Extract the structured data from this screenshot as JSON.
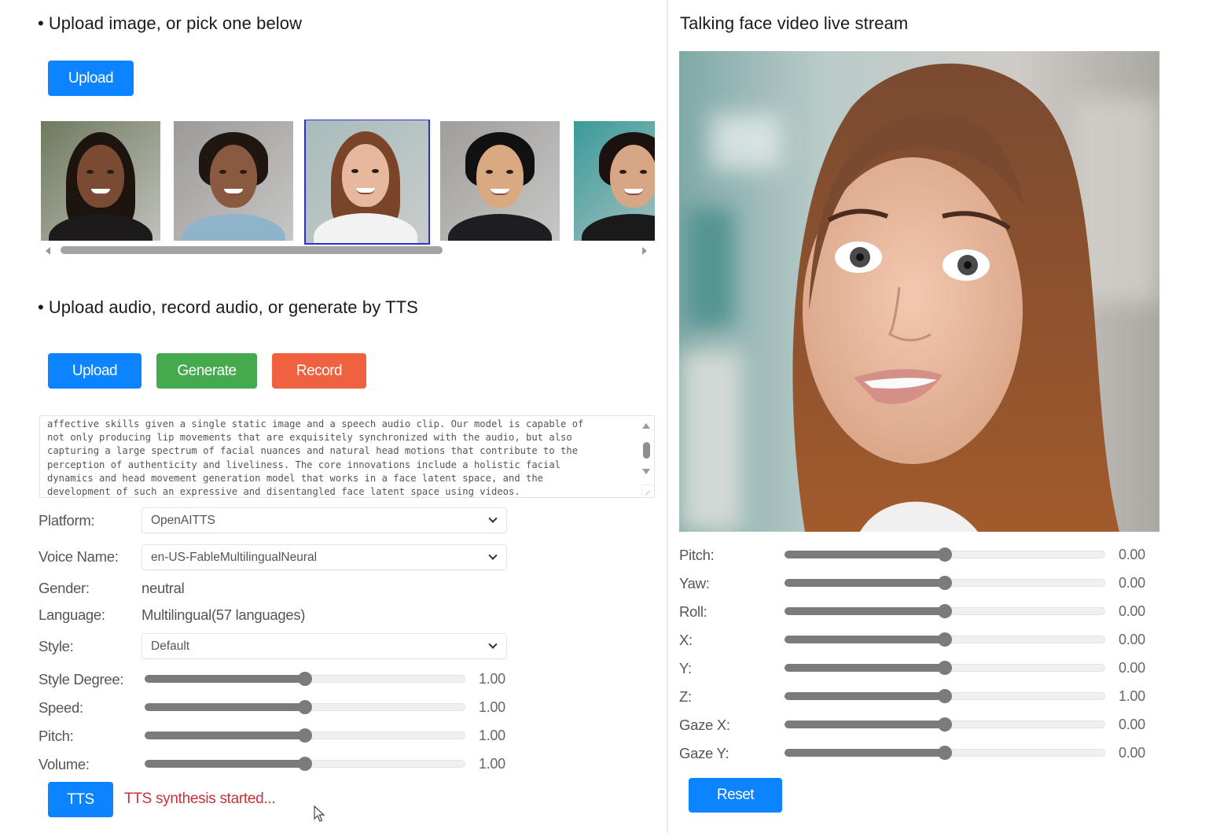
{
  "image_section": {
    "title": "Upload image, or pick one below",
    "upload_label": "Upload",
    "thumbnails": [
      {
        "name": "woman-curly-hair",
        "selected": false,
        "colors": {
          "bg": "#6f7a5d",
          "skin": "#7a4a32",
          "hair": "#1e140f",
          "clothes": "#1c1a1a"
        }
      },
      {
        "name": "man-short-hair",
        "selected": false,
        "colors": {
          "bg": "#9c9a98",
          "skin": "#8a5a40",
          "hair": "#1f1612",
          "clothes": "#8fb3c9"
        }
      },
      {
        "name": "woman-long-brown-hair",
        "selected": true,
        "colors": {
          "bg": "#a7bcbb",
          "skin": "#e8b89e",
          "hair": "#7a4428",
          "clothes": "#f2f2f2"
        }
      },
      {
        "name": "man-suit",
        "selected": false,
        "colors": {
          "bg": "#a09e9c",
          "skin": "#d9a982",
          "hair": "#111111",
          "clothes": "#1e1e22"
        }
      },
      {
        "name": "woman-short-dark-hair",
        "selected": false,
        "colors": {
          "bg": "#3a9a9a",
          "skin": "#d7a684",
          "hair": "#1b1210",
          "clothes": "#1a1a1a"
        }
      }
    ]
  },
  "audio_section": {
    "title": "Upload audio, record audio, or generate by TTS",
    "upload_label": "Upload",
    "generate_label": "Generate",
    "record_label": "Record",
    "tts_text": "affective skills given a single static image and a speech audio clip. Our model is capable of\nnot only producing lip movements that are exquisitely synchronized with the audio, but also\ncapturing a large spectrum of facial nuances and natural head motions that contribute to the\nperception of authenticity and liveliness. The core innovations include a holistic facial\ndynamics and head movement generation model that works in a face latent space, and the\ndevelopment of such an expressive and disentangled face latent space using videos.",
    "platform_label": "Platform:",
    "platform_value": "OpenAITTS",
    "voice_label": "Voice Name:",
    "voice_value": "en-US-FableMultilingualNeural",
    "gender_label": "Gender:",
    "gender_value": "neutral",
    "language_label": "Language:",
    "language_value": "Multilingual(57 languages)",
    "style_label": "Style:",
    "style_value": "Default",
    "sliders": [
      {
        "label": "Style Degree:",
        "value": "1.00",
        "fraction": 0.5
      },
      {
        "label": "Speed:",
        "value": "1.00",
        "fraction": 0.5
      },
      {
        "label": "Pitch:",
        "value": "1.00",
        "fraction": 0.5
      },
      {
        "label": "Volume:",
        "value": "1.00",
        "fraction": 0.5
      }
    ],
    "tts_label": "TTS",
    "status": "TTS synthesis started..."
  },
  "video_section": {
    "title": "Talking face video live stream",
    "sliders": [
      {
        "label": "Pitch:",
        "value": "0.00",
        "fraction": 0.5
      },
      {
        "label": "Yaw:",
        "value": "0.00",
        "fraction": 0.5
      },
      {
        "label": "Roll:",
        "value": "0.00",
        "fraction": 0.5
      },
      {
        "label": "X:",
        "value": "0.00",
        "fraction": 0.5
      },
      {
        "label": "Y:",
        "value": "0.00",
        "fraction": 0.5
      },
      {
        "label": "Z:",
        "value": "1.00",
        "fraction": 0.5
      },
      {
        "label": "Gaze X:",
        "value": "0.00",
        "fraction": 0.5
      },
      {
        "label": "Gaze Y:",
        "value": "0.00",
        "fraction": 0.5
      }
    ],
    "reset_label": "Reset"
  },
  "colors": {
    "primary_blue": "#0d84ff",
    "generate_green": "#45a94d",
    "record_red": "#ef613f",
    "status_red": "#c8323a",
    "selected_outline": "#2a2fd6"
  }
}
